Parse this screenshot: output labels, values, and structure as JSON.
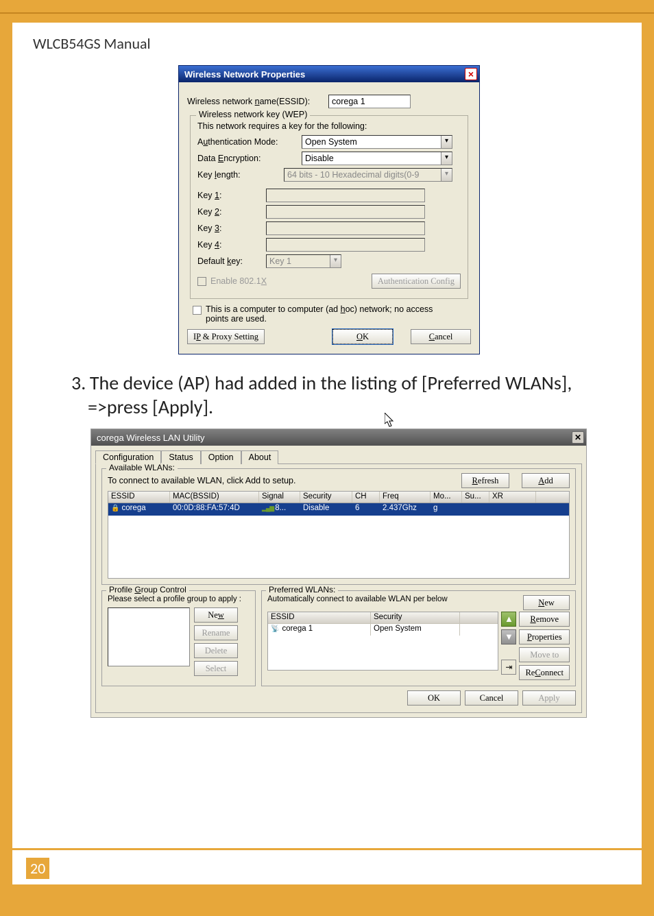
{
  "doc": {
    "title": "WLCB54GS Manual",
    "page_number": "20",
    "step_text": "3. The device (AP) had added in the listing of [Preferred WLANs], =>press [Apply]."
  },
  "dlg1": {
    "title": "Wireless Network Properties",
    "essid_label": "Wireless network name(ESSID):",
    "essid_value": "corega 1",
    "wep_group": "Wireless network key (WEP)",
    "wep_desc": "This network requires a key for the following:",
    "auth_label": "Authentication Mode:",
    "auth_value": "Open System",
    "enc_label": "Data Encryption:",
    "enc_value": "Disable",
    "keylen_label": "Key length:",
    "keylen_value": "64 bits - 10 Hexadecimal digits(0-9",
    "key1": "Key 1:",
    "key2": "Key 2:",
    "key3": "Key 3:",
    "key4": "Key 4:",
    "defaultkey_label": "Default key:",
    "defaultkey_value": "Key 1",
    "enable8021x": "Enable 802.1X",
    "authcfg_btn": "Authentication Config",
    "adhoc_label": "This is a computer to computer (ad hoc) network; no access points are used.",
    "ipproxy_btn": "IP & Proxy Setting",
    "ok_btn": "OK",
    "cancel_btn": "Cancel"
  },
  "dlg2": {
    "title": "corega Wireless LAN Utility",
    "tabs": [
      "Configuration",
      "Status",
      "Option",
      "About"
    ],
    "avail_group": "Available WLANs:",
    "avail_desc": "To connect to available WLAN, click Add to setup.",
    "refresh_btn": "Refresh",
    "add_btn": "Add",
    "avail_headers": [
      "ESSID",
      "MAC(BSSID)",
      "Signal",
      "Security",
      "CH",
      "Freq",
      "Mo...",
      "Su...",
      "XR"
    ],
    "avail_row": {
      "essid": "corega",
      "mac": "00:0D:88:FA:57:4D",
      "signal": "8...",
      "security": "Disable",
      "ch": "6",
      "freq": "2.437Ghz",
      "mode": "g",
      "su": "",
      "xr": ""
    },
    "profile_group": "Profile Group Control",
    "profile_desc": "Please select a profile group to apply :",
    "profile_btns": {
      "new": "New",
      "rename": "Rename",
      "delete": "Delete",
      "select": "Select"
    },
    "pref_group": "Preferred WLANs:",
    "pref_desc": "Automatically connect to available WLAN per below",
    "pref_headers": [
      "ESSID",
      "Security"
    ],
    "pref_row": {
      "essid": "corega 1",
      "security": "Open System"
    },
    "pref_btns": {
      "new": "New",
      "remove": "Remove",
      "properties": "Properties",
      "moveto": "Move to",
      "reconnect": "ReConnect"
    },
    "bottom_btns": {
      "ok": "OK",
      "cancel": "Cancel",
      "apply": "Apply"
    }
  }
}
